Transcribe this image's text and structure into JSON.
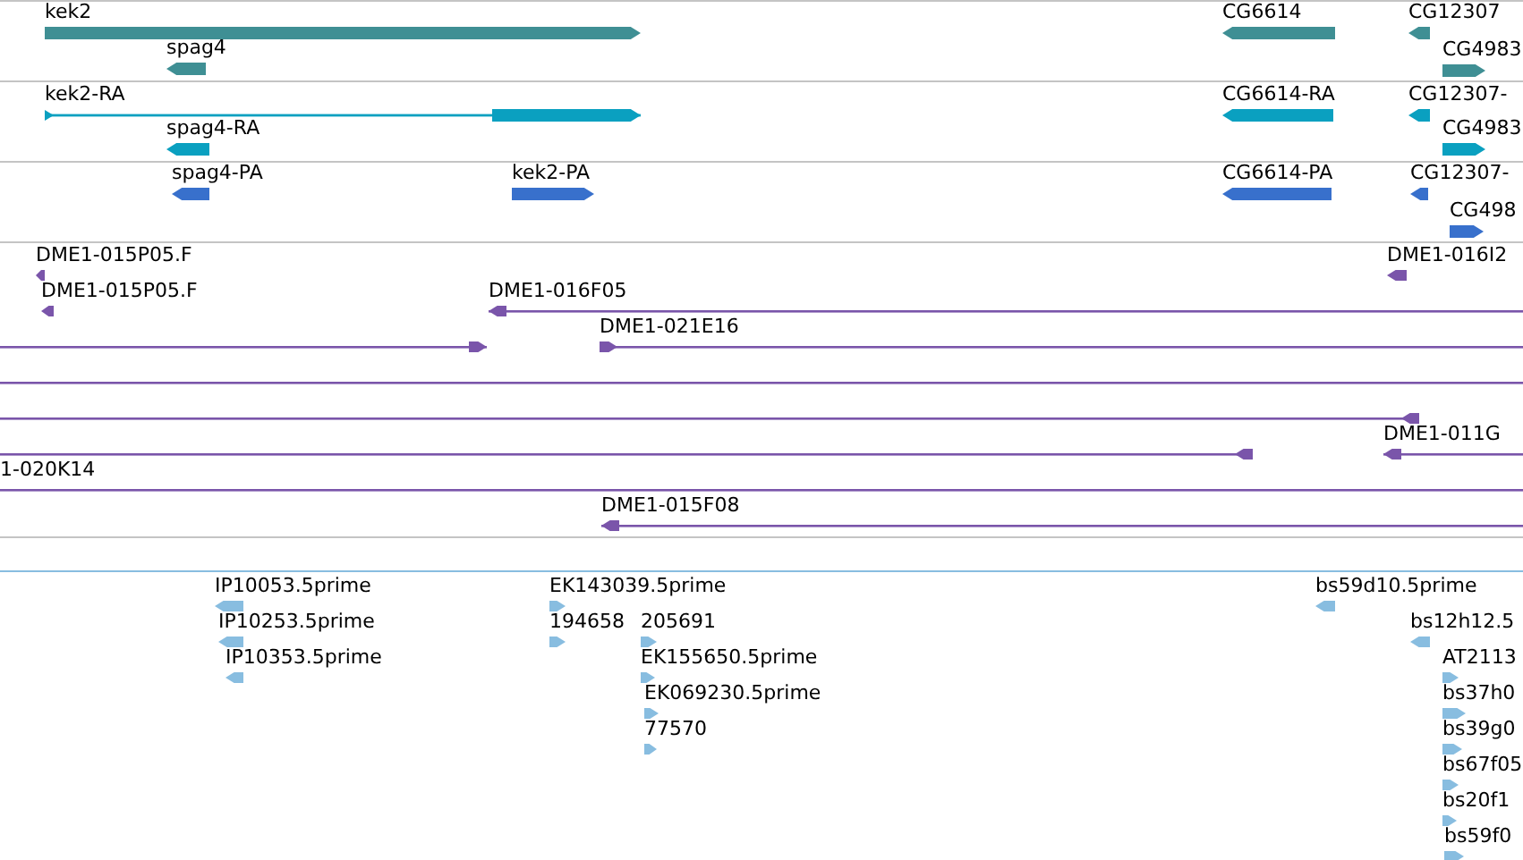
{
  "tracks": [
    {
      "kind": "gene",
      "features": [
        {
          "label": "kek2",
          "reverse": false
        },
        {
          "label": "spag4",
          "reverse": true
        },
        {
          "label": "CG6614",
          "reverse": true
        },
        {
          "label": "CG12307",
          "reverse": true
        },
        {
          "label": "CG4983",
          "reverse": false
        }
      ]
    },
    {
      "kind": "transcript",
      "features": [
        {
          "label": "kek2-RA",
          "reverse": false
        },
        {
          "label": "spag4-RA",
          "reverse": true
        },
        {
          "label": "CG6614-RA",
          "reverse": true
        },
        {
          "label": "CG12307-",
          "reverse": true
        },
        {
          "label": "CG4983",
          "reverse": false
        }
      ]
    },
    {
      "kind": "protein",
      "features": [
        {
          "label": "spag4-PA",
          "reverse": true
        },
        {
          "label": "kek2-PA",
          "reverse": false
        },
        {
          "label": "CG6614-PA",
          "reverse": true
        },
        {
          "label": "CG12307-",
          "reverse": true
        },
        {
          "label": "CG498",
          "reverse": false
        }
      ]
    },
    {
      "kind": "clone",
      "features": [
        {
          "label": "DME1-015P05.F",
          "arrowhead": true,
          "reverse": true
        },
        {
          "label": "DME1-016I2",
          "arrowhead": true,
          "reverse": true
        },
        {
          "label": "DME1-015P05.F",
          "arrowhead": true,
          "reverse": true
        },
        {
          "label": "DME1-016F05",
          "arrowhead": true,
          "reverse": true
        },
        {
          "arrowhead": true,
          "reverse": false
        },
        {
          "label": "DME1-021E16",
          "arrowhead": true,
          "reverse": false
        },
        {
          "arrowhead": false
        },
        {
          "arrowhead": true,
          "reverse": true
        },
        {
          "label": "DME1-011G",
          "arrowhead": true,
          "reverse": true
        },
        {
          "arrowhead": true,
          "reverse": true
        },
        {
          "label": "1-020K14",
          "arrowhead": false
        },
        {
          "label": "DME1-015F08",
          "arrowhead": true,
          "reverse": true
        }
      ]
    },
    {
      "kind": "est",
      "features": [
        {
          "label": "IP10053.5prime",
          "reverse": true
        },
        {
          "label": "EK143039.5prime",
          "reverse": false
        },
        {
          "label": "bs59d10.5prime",
          "reverse": true
        },
        {
          "label": "IP10253.5prime",
          "reverse": true
        },
        {
          "label": "194658",
          "reverse": false
        },
        {
          "label": "205691",
          "reverse": false
        },
        {
          "label": "bs12h12.5",
          "reverse": true
        },
        {
          "label": "IP10353.5prime",
          "reverse": true
        },
        {
          "label": "EK155650.5prime",
          "reverse": false
        },
        {
          "label": "AT2113",
          "reverse": false
        },
        {
          "label": "EK069230.5prime",
          "reverse": false
        },
        {
          "label": "bs37h0",
          "reverse": false
        },
        {
          "label": "77570",
          "reverse": false
        },
        {
          "label": "bs39g0",
          "reverse": false
        },
        {
          "label": "bs67f05",
          "reverse": false
        },
        {
          "label": "bs20f1",
          "reverse": false
        },
        {
          "label": "bs59f0",
          "reverse": false
        }
      ]
    }
  ]
}
